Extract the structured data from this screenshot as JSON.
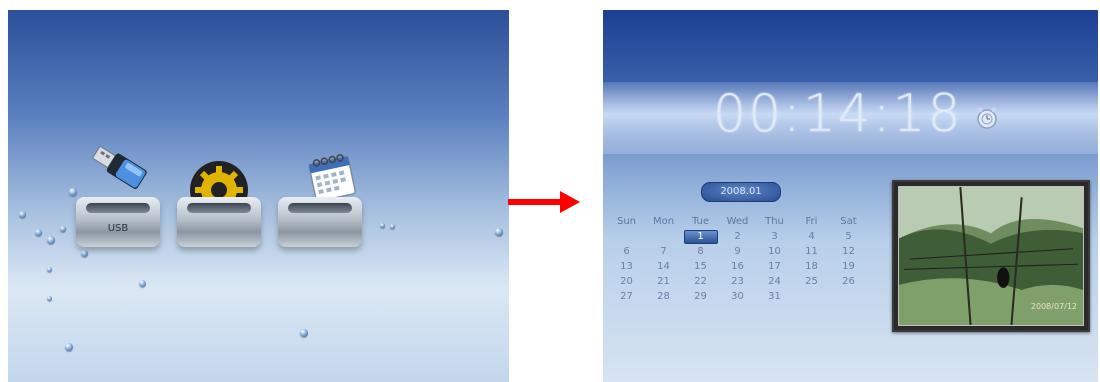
{
  "left_screen": {
    "docks": [
      {
        "label": "USB"
      },
      {
        "label": ""
      },
      {
        "label": ""
      }
    ]
  },
  "right_screen": {
    "clock": "00:14:18",
    "month": "2008.01",
    "weekdays": [
      "Sun",
      "Mon",
      "Tue",
      "Wed",
      "Thu",
      "Fri",
      "Sat"
    ],
    "weeks": [
      [
        "",
        "",
        "1",
        "2",
        "3",
        "4",
        "5"
      ],
      [
        "6",
        "7",
        "8",
        "9",
        "10",
        "11",
        "12"
      ],
      [
        "13",
        "14",
        "15",
        "16",
        "17",
        "18",
        "19"
      ],
      [
        "20",
        "21",
        "22",
        "23",
        "24",
        "25",
        "26"
      ],
      [
        "27",
        "28",
        "29",
        "30",
        "31",
        "",
        ""
      ]
    ],
    "selected_day": "1",
    "photo_date": "2008/07/12"
  },
  "colors": {
    "arrow": "#ff0000",
    "gear": "#e0b400"
  }
}
